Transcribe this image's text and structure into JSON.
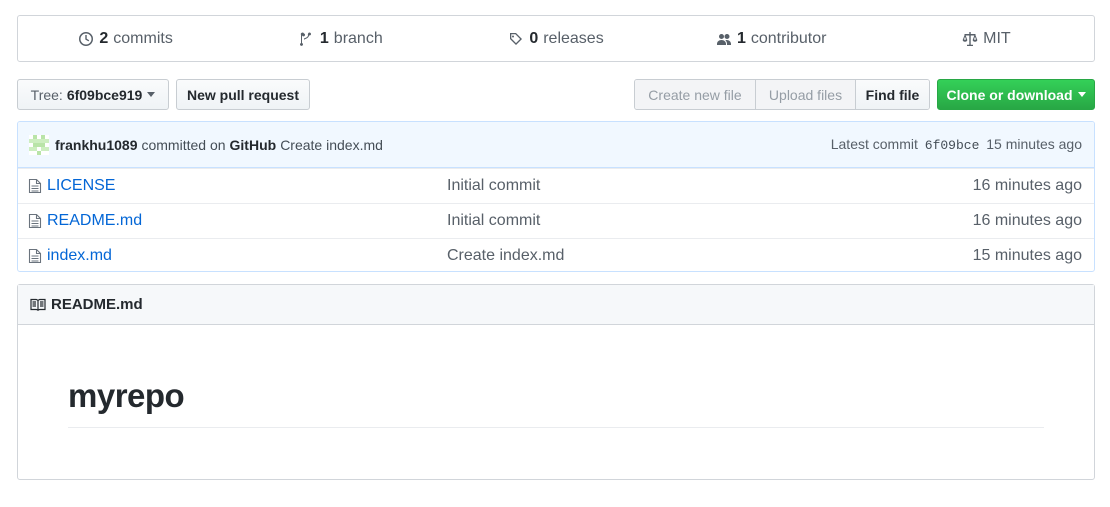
{
  "summary": {
    "commits": {
      "num": "2",
      "label": "commits"
    },
    "branch": {
      "num": "1",
      "label": "branch"
    },
    "releases": {
      "num": "0",
      "label": "releases"
    },
    "contributor": {
      "num": "1",
      "label": "contributor"
    },
    "license": {
      "label": "MIT"
    }
  },
  "toolbar": {
    "tree_label": "Tree:",
    "tree_sha": "6f09bce919",
    "new_pull_request": "New pull request",
    "create_new_file": "Create new file",
    "upload_files": "Upload files",
    "find_file": "Find file",
    "clone_or_download": "Clone or download"
  },
  "commit": {
    "author": "frankhu1089",
    "committed_on": "committed on",
    "platform": "GitHub",
    "message": "Create index.md",
    "latest_label": "Latest commit",
    "sha": "6f09bce",
    "age": "15 minutes ago"
  },
  "files": [
    {
      "name": "LICENSE",
      "message": "Initial commit",
      "age": "16 minutes ago"
    },
    {
      "name": "README.md",
      "message": "Initial commit",
      "age": "16 minutes ago"
    },
    {
      "name": "index.md",
      "message": "Create index.md",
      "age": "15 minutes ago"
    }
  ],
  "readme": {
    "header": "README.md",
    "title": "myrepo"
  },
  "colors": {
    "link": "#0366d6",
    "primary_button": "#28a745",
    "commit_bar_bg": "#f1f8ff"
  }
}
